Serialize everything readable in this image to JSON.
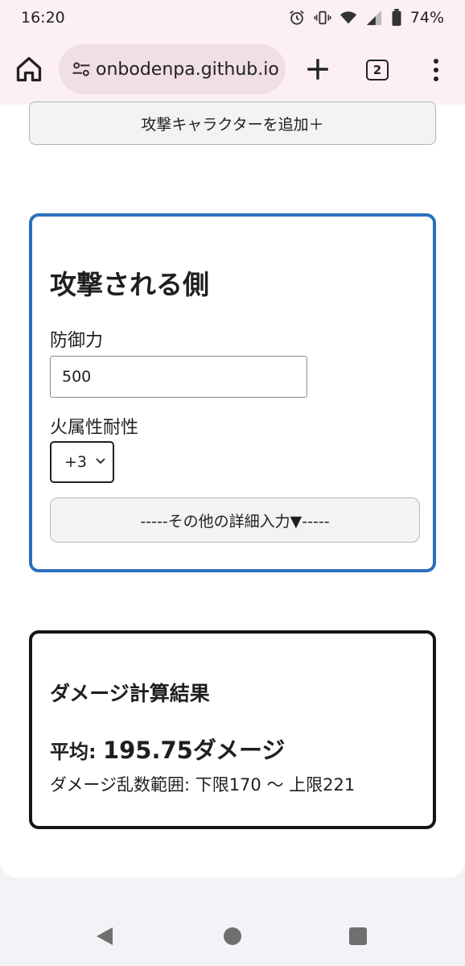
{
  "status_bar": {
    "time": "16:20",
    "battery": "74%",
    "icons": [
      "alarm-icon",
      "vibrate-icon",
      "wifi-icon",
      "signal-icon",
      "battery-icon"
    ]
  },
  "browser": {
    "url": "onbodenpa.github.io",
    "tab_count": "2",
    "icons": [
      "home-icon",
      "site-settings-icon",
      "plus-icon",
      "more-vert-icon"
    ]
  },
  "page": {
    "add_attacker_label": "攻撃キャラクターを追加＋",
    "defender": {
      "title": "攻撃される側",
      "defense_label": "防御力",
      "defense_value": "500",
      "resist_label": "火属性耐性",
      "resist_value": "+3",
      "details_label": "-----その他の詳細入力▼-----"
    },
    "result": {
      "title": "ダメージ計算結果",
      "avg_label": "平均: ",
      "avg_value": "195.75ダメージ",
      "range_text": "ダメージ乱数範囲: 下限170 〜 上限221"
    }
  },
  "colors": {
    "defender_border": "#2b70bd",
    "result_border": "#151515",
    "browser_bg": "#fcf0f5"
  }
}
